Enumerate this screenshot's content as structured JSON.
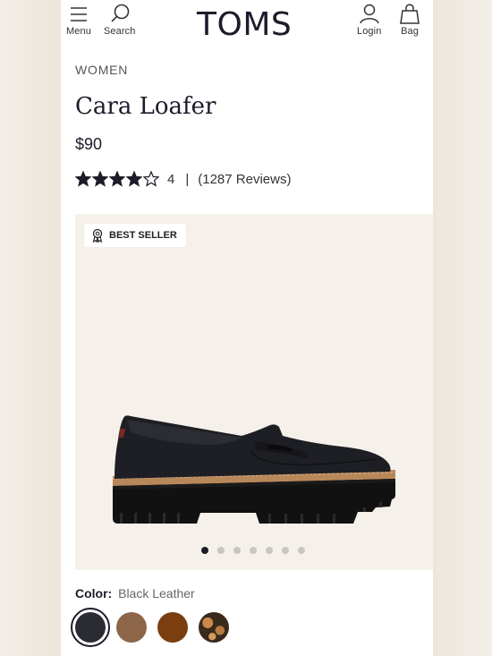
{
  "header": {
    "menu_label": "Menu",
    "search_label": "Search",
    "brand": "TOMS",
    "login_label": "Login",
    "bag_label": "Bag"
  },
  "product": {
    "category": "WOMEN",
    "name": "Cara Loafer",
    "price": "$90",
    "rating": {
      "score": 4,
      "max": 5,
      "score_text": "4",
      "separator": "|",
      "reviews": "(1287 Reviews)"
    },
    "badge": "BEST SELLER",
    "gallery": {
      "image_count": 7,
      "active_index": 0
    },
    "color_label": "Color:",
    "color_value": "Black Leather",
    "swatches": [
      {
        "name": "black",
        "color": "#2b2c33",
        "selected": true
      },
      {
        "name": "tan",
        "color": "#8d6549",
        "selected": false
      },
      {
        "name": "cognac",
        "color": "#7a3e10",
        "selected": false
      },
      {
        "name": "leopard",
        "color": "#3a2a1c",
        "selected": false
      }
    ]
  },
  "colors": {
    "text": "#1c1c2b",
    "gallery_bg": "#f5f1ea",
    "dot_active": "#1c1c2b",
    "dot_inactive": "#c9c6c1"
  }
}
